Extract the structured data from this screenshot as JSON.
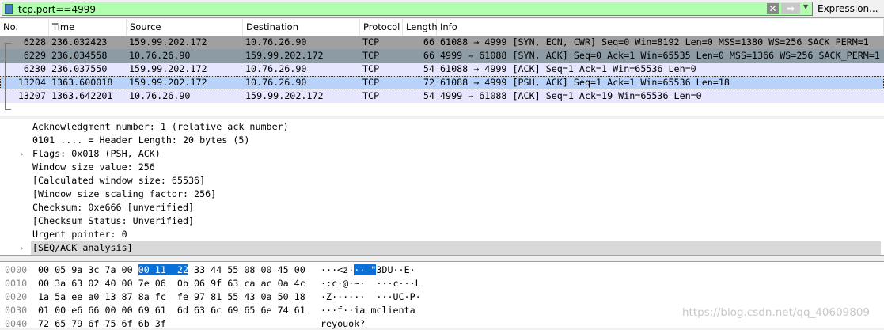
{
  "filter": {
    "value": "tcp.port==4999",
    "expression_label": "Expression..."
  },
  "columns": [
    "No.",
    "Time",
    "Source",
    "Destination",
    "Protocol",
    "Length",
    "Info"
  ],
  "packets": [
    {
      "no": "6228",
      "time": "236.032423",
      "src": "159.99.202.172",
      "dst": "10.76.26.90",
      "proto": "TCP",
      "len": "66",
      "info": "61088 → 4999 [SYN, ECN, CWR] Seq=0 Win=8192 Len=0 MSS=1380 WS=256 SACK_PERM=1",
      "bg": "#a0a0a0"
    },
    {
      "no": "6229",
      "time": "236.034558",
      "src": "10.76.26.90",
      "dst": "159.99.202.172",
      "proto": "TCP",
      "len": "66",
      "info": "4999 → 61088 [SYN, ACK] Seq=0 Ack=1 Win=65535 Len=0 MSS=1366 WS=256 SACK_PERM=1",
      "bg": "#8d9ba5"
    },
    {
      "no": "6230",
      "time": "236.037550",
      "src": "159.99.202.172",
      "dst": "10.76.26.90",
      "proto": "TCP",
      "len": "54",
      "info": "61088 → 4999 [ACK] Seq=1 Ack=1 Win=65536 Len=0",
      "bg": "#e7e6ff"
    },
    {
      "no": "13204",
      "time": "1363.600018",
      "src": "159.99.202.172",
      "dst": "10.76.26.90",
      "proto": "TCP",
      "len": "72",
      "info": "61088 → 4999 [PSH, ACK] Seq=1 Ack=1 Win=65536 Len=18",
      "bg": "#b9d2f9"
    },
    {
      "no": "13207",
      "time": "1363.642201",
      "src": "10.76.26.90",
      "dst": "159.99.202.172",
      "proto": "TCP",
      "len": "54",
      "info": "4999 → 61088 [ACK] Seq=1 Ack=19 Win=65536 Len=0",
      "bg": "#e7e6ff"
    }
  ],
  "details": [
    {
      "text": "Acknowledgment number: 1    (relative ack number)",
      "expandable": false
    },
    {
      "text": "0101 .... = Header Length: 20 bytes (5)",
      "expandable": false
    },
    {
      "text": "Flags: 0x018 (PSH, ACK)",
      "expandable": true
    },
    {
      "text": "Window size value: 256",
      "expandable": false
    },
    {
      "text": "[Calculated window size: 65536]",
      "expandable": false
    },
    {
      "text": "[Window size scaling factor: 256]",
      "expandable": false
    },
    {
      "text": "Checksum: 0xe666 [unverified]",
      "expandable": false
    },
    {
      "text": "[Checksum Status: Unverified]",
      "expandable": false
    },
    {
      "text": "Urgent pointer: 0",
      "expandable": false
    },
    {
      "text": "[SEQ/ACK analysis]",
      "expandable": true,
      "selected": true
    }
  ],
  "bytes": [
    {
      "offset": "0000",
      "hex_pre": "00 05 9a 3c 7a 00 ",
      "hex_hl": "00 11  22",
      "hex_post": " 33 44 55 08 00 45 00",
      "asc_pre": "···<z·",
      "asc_hl": "·· \"",
      "asc_post": "3DU··E·"
    },
    {
      "offset": "0010",
      "hex": "00 3a 63 02 40 00 7e 06  0b 06 9f 63 ca ac 0a 4c",
      "asc": "·:c·@·~·  ···c···L"
    },
    {
      "offset": "0020",
      "hex": "1a 5a ee a0 13 87 8a fc  fe 97 81 55 43 0a 50 18",
      "asc": "·Z······  ···UC·P·"
    },
    {
      "offset": "0030",
      "hex": "01 00 e6 66 00 00 69 61  6d 63 6c 69 65 6e 74 61",
      "asc": "···f··ia mclienta"
    },
    {
      "offset": "0040",
      "hex": "72 65 79 6f 75 6f 6b 3f",
      "asc": "reyouok?"
    }
  ],
  "watermark": "https://blog.csdn.net/qq_40609809"
}
